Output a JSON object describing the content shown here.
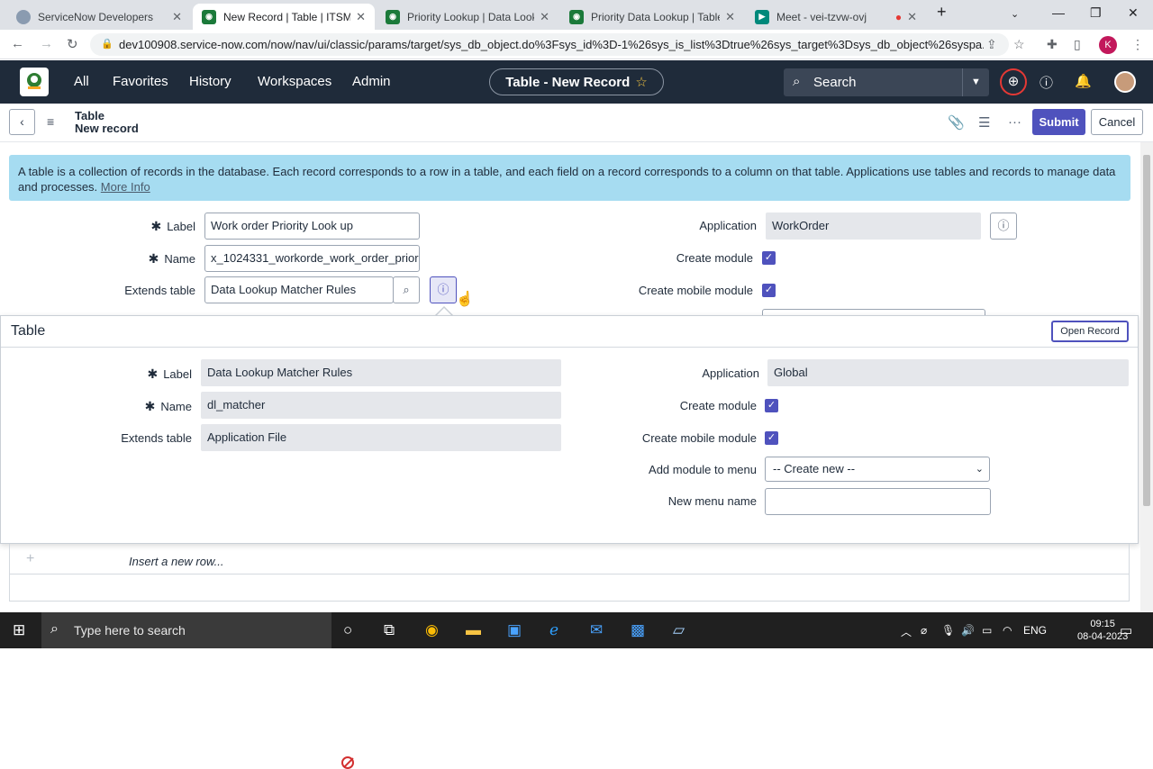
{
  "browser": {
    "tabs": [
      {
        "title": "ServiceNow Developers",
        "favicon_color": "#8a9bb0"
      },
      {
        "title": "New Record | Table | ITSM Mo",
        "favicon_color": "#1b7a3a"
      },
      {
        "title": "Priority Lookup | Data Looku",
        "favicon_color": "#1b7a3a"
      },
      {
        "title": "Priority Data Lookup | Table |",
        "favicon_color": "#1b7a3a"
      },
      {
        "title": "Meet - vei-tzvw-ovj",
        "favicon_color": "#00897b"
      }
    ],
    "url": "dev100908.service-now.com/now/nav/ui/classic/params/target/sys_db_object.do%3Fsys_id%3D-1%26sys_is_list%3Dtrue%26sys_target%3Dsys_db_object%26syspa...",
    "profile_initial": "K"
  },
  "header": {
    "menu": [
      "All",
      "Favorites",
      "History",
      "Workspaces",
      "Admin"
    ],
    "context_pill": "Table - New Record",
    "search_label": "Search"
  },
  "form_header": {
    "title_line1": "Table",
    "title_line2": "New record",
    "submit_label": "Submit",
    "cancel_label": "Cancel"
  },
  "info_banner": {
    "text": "A table is a collection of records in the database. Each record corresponds to a row in a table, and each field on a record corresponds to a column on that table. Applications use tables and records to manage data and processes.",
    "link": "More Info"
  },
  "form": {
    "label_label": "Label",
    "label_value": "Work order Priority Look up",
    "name_label": "Name",
    "name_value": "x_1024331_workorde_work_order_prior",
    "extends_label": "Extends table",
    "extends_value": "Data Lookup Matcher Rules",
    "application_label": "Application",
    "application_value": "WorkOrder",
    "create_module_label": "Create module",
    "create_mobile_module_label": "Create mobile module"
  },
  "popup": {
    "title": "Table",
    "open_record_label": "Open Record",
    "label_label": "Label",
    "label_value": "Data Lookup Matcher Rules",
    "name_label": "Name",
    "name_value": "dl_matcher",
    "extends_label": "Extends table",
    "extends_value": "Application File",
    "application_label": "Application",
    "application_value": "Global",
    "create_module_label": "Create module",
    "create_mobile_module_label": "Create mobile module",
    "add_module_label": "Add module to menu",
    "add_module_value": "-- Create new --",
    "new_menu_label": "New menu name",
    "new_menu_value": ""
  },
  "related_list": {
    "insert_row_text": "Insert a new row..."
  },
  "taskbar": {
    "search_placeholder": "Type here to search",
    "language": "ENG",
    "time": "09:15",
    "date": "08-04-2023"
  },
  "colors": {
    "nav_bg": "#1f2b3a",
    "accent": "#4f52bd",
    "info_bg": "#a6dcf1"
  }
}
